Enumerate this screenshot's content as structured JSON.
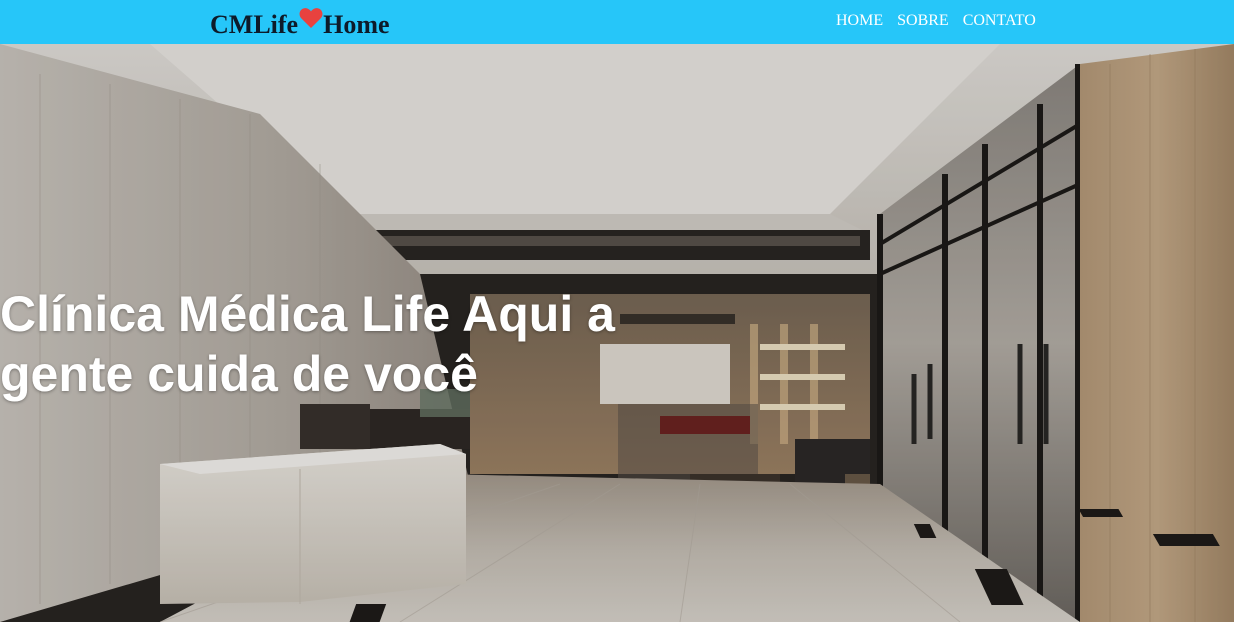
{
  "colors": {
    "navbar_bg": "#26c6f9",
    "logo_text": "#0d1b2a",
    "heart": "#e8423f",
    "nav_link": "#ffffff",
    "hero_text": "#ffffff"
  },
  "header": {
    "logo": {
      "prefix": "CMLife",
      "icon": "heart-icon",
      "suffix": "Home"
    },
    "nav": [
      {
        "label": "HOME"
      },
      {
        "label": "SOBRE"
      },
      {
        "label": "CONTATO"
      }
    ]
  },
  "hero": {
    "title": "Clínica Médica Life Aqui a gente cuida de você",
    "image_subject": "modern clinic reception lobby"
  }
}
